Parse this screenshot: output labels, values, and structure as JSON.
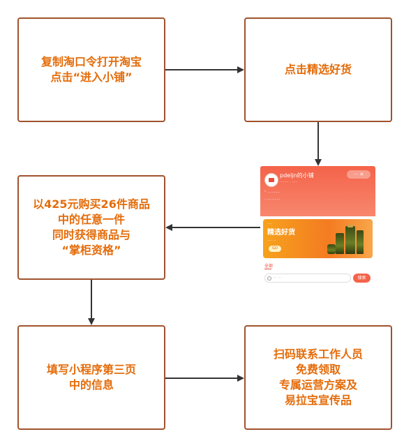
{
  "boxes": {
    "copy_code": {
      "line1": "复制淘口令打开淘宝",
      "line2": "点击“进入小铺”"
    },
    "select_goods": {
      "line1": "点击精选好货"
    },
    "purchase": {
      "line1": "以425元购买26件商品",
      "line2": "中的任意一件",
      "line3": "同时获得商品与",
      "line4": "“掌柜资格”"
    },
    "fill_form": {
      "line1": "填写小程序第三页",
      "line2": "中的信息"
    },
    "contact": {
      "line1": "扫码联系工作人员",
      "line2": "免费领取",
      "line3": "专属运营方案及",
      "line4": "易拉宝宣传品"
    }
  },
  "screenshot": {
    "shop_name": "pdeljn的小铺",
    "banner_title": "精选好货",
    "banner_button": "GO",
    "tab_all": "全部",
    "search_button": "搜索"
  },
  "colors": {
    "box_border": "#a0522d",
    "box_text": "#e46c0a",
    "arrow": "#333333",
    "screenshot_header": "#f4634a",
    "banner": "#f47b22"
  }
}
